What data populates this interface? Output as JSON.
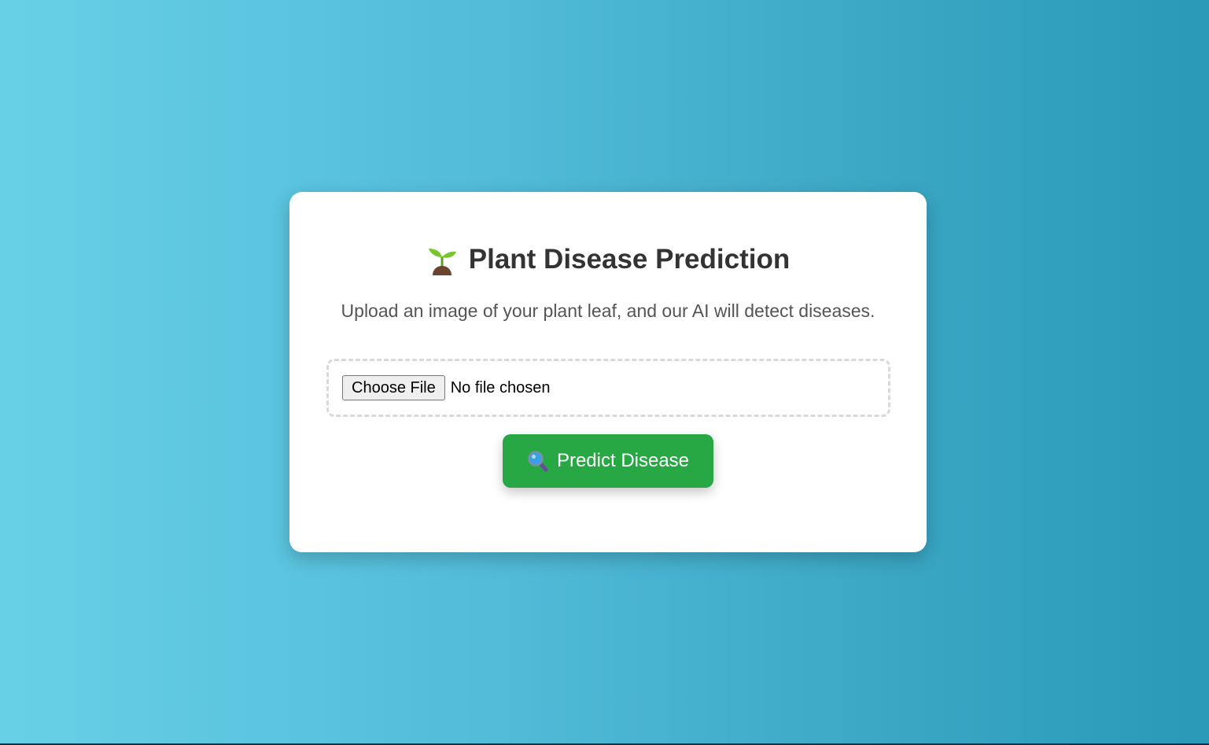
{
  "page": {
    "title": "Plant Disease Prediction",
    "subtitle": "Upload an image of your plant leaf, and our AI will detect diseases.",
    "title_icon": "sprout-icon"
  },
  "upload": {
    "choose_file_label": "Choose File",
    "file_status": "No file chosen"
  },
  "predict_button": {
    "label": "Predict Disease",
    "icon": "magnifier-icon",
    "color": "#28a745"
  },
  "colors": {
    "background_start": "#68d0e6",
    "background_end": "#279ab8",
    "card": "#ffffff",
    "title_text": "#333333",
    "subtitle_text": "#555555"
  }
}
